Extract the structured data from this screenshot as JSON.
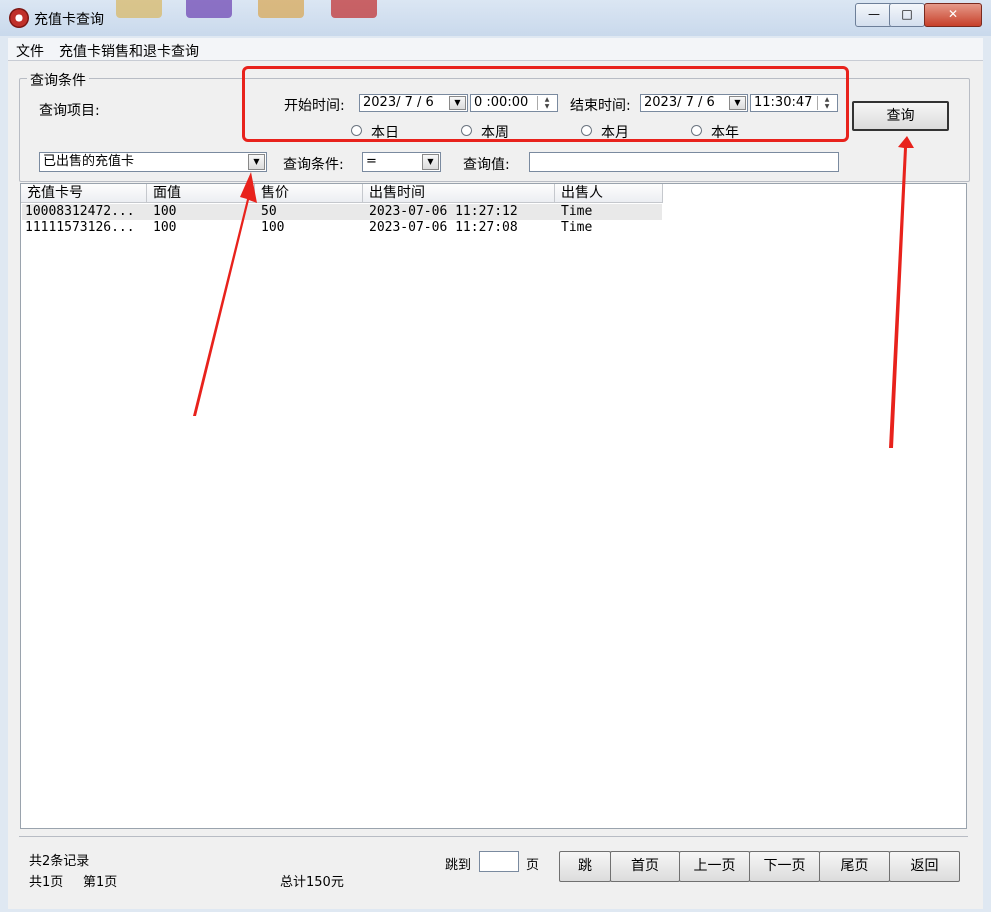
{
  "window": {
    "title": "充值卡查询",
    "minimize": "—",
    "maximize": "□",
    "close": "✕"
  },
  "menu": {
    "items": [
      "文件",
      "充值卡销售和退卡查询"
    ]
  },
  "query": {
    "group_label": "查询条件",
    "item_label": "查询项目:",
    "start_label": "开始时间:",
    "start_date": "2023/ 7 / 6",
    "start_time": "0 :00:00",
    "end_label": "结束时间:",
    "end_date": "2023/ 7 / 6",
    "end_time": "11:30:47",
    "radios": [
      "本日",
      "本周",
      "本月",
      "本年"
    ],
    "search_button": "查询",
    "item_select": "已出售的充值卡",
    "condition_label": "查询条件:",
    "condition_value": "=",
    "value_label": "查询值:",
    "value_input": ""
  },
  "table": {
    "headers": [
      "充值卡号",
      "面值",
      "售价",
      "出售时间",
      "出售人"
    ],
    "rows": [
      [
        "10008312472...",
        "100",
        "50",
        "2023-07-06 11:27:12",
        "Time"
      ],
      [
        "11111573126...",
        "100",
        "100",
        "2023-07-06 11:27:08",
        "Time"
      ]
    ]
  },
  "footer": {
    "records": "共2条记录",
    "pages": "共1页",
    "current_page": "第1页",
    "total": "总计150元",
    "jump_label": "跳到",
    "page_unit": "页",
    "jump_value": "",
    "buttons": [
      "跳",
      "首页",
      "上一页",
      "下一页",
      "尾页",
      "返回"
    ]
  },
  "colors": {
    "annotation": "#e8221c"
  }
}
